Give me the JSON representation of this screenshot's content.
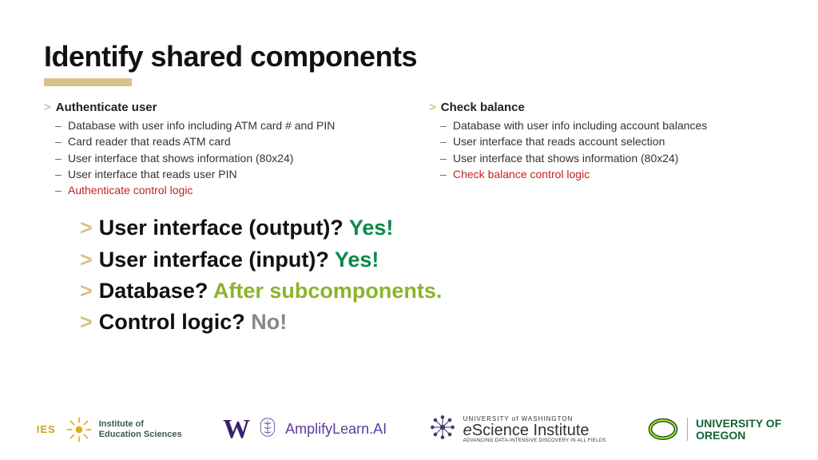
{
  "title": "Identify shared components",
  "col_left": {
    "heading": "Authenticate user",
    "items": [
      "Database with user info including ATM card # and PIN",
      "Card reader that reads ATM card",
      "User interface that shows information (80x24)",
      "User interface that reads user PIN"
    ],
    "red_item": "Authenticate control logic"
  },
  "col_right": {
    "heading": "Check balance",
    "items": [
      "Database with user info including account balances",
      "User interface that reads account selection",
      "User interface that shows information (80x24)"
    ],
    "red_item": "Check balance control logic"
  },
  "questions": [
    {
      "q": "User interface (output)? ",
      "a": "Yes!",
      "cls": "ans-green"
    },
    {
      "q": "User interface (input)? ",
      "a": "Yes!",
      "cls": "ans-green"
    },
    {
      "q": "Database? ",
      "a": "After subcomponents.",
      "cls": "ans-olive"
    },
    {
      "q": "Control logic? ",
      "a": "No!",
      "cls": "ans-grey"
    }
  ],
  "logos": {
    "ies_label": "IES",
    "ies_line1": "Institute of",
    "ies_line2": "Education Sciences",
    "amplify": "AmplifyLearn.AI",
    "escience_uw": "UNIVERSITY of WASHINGTON",
    "escience_main_e": "e",
    "escience_main_rest": "Science Institute",
    "escience_sub": "ADVANCING DATA-INTENSIVE DISCOVERY IN ALL FIELDS",
    "oregon_line1": "UNIVERSITY OF",
    "oregon_line2": "OREGON"
  }
}
